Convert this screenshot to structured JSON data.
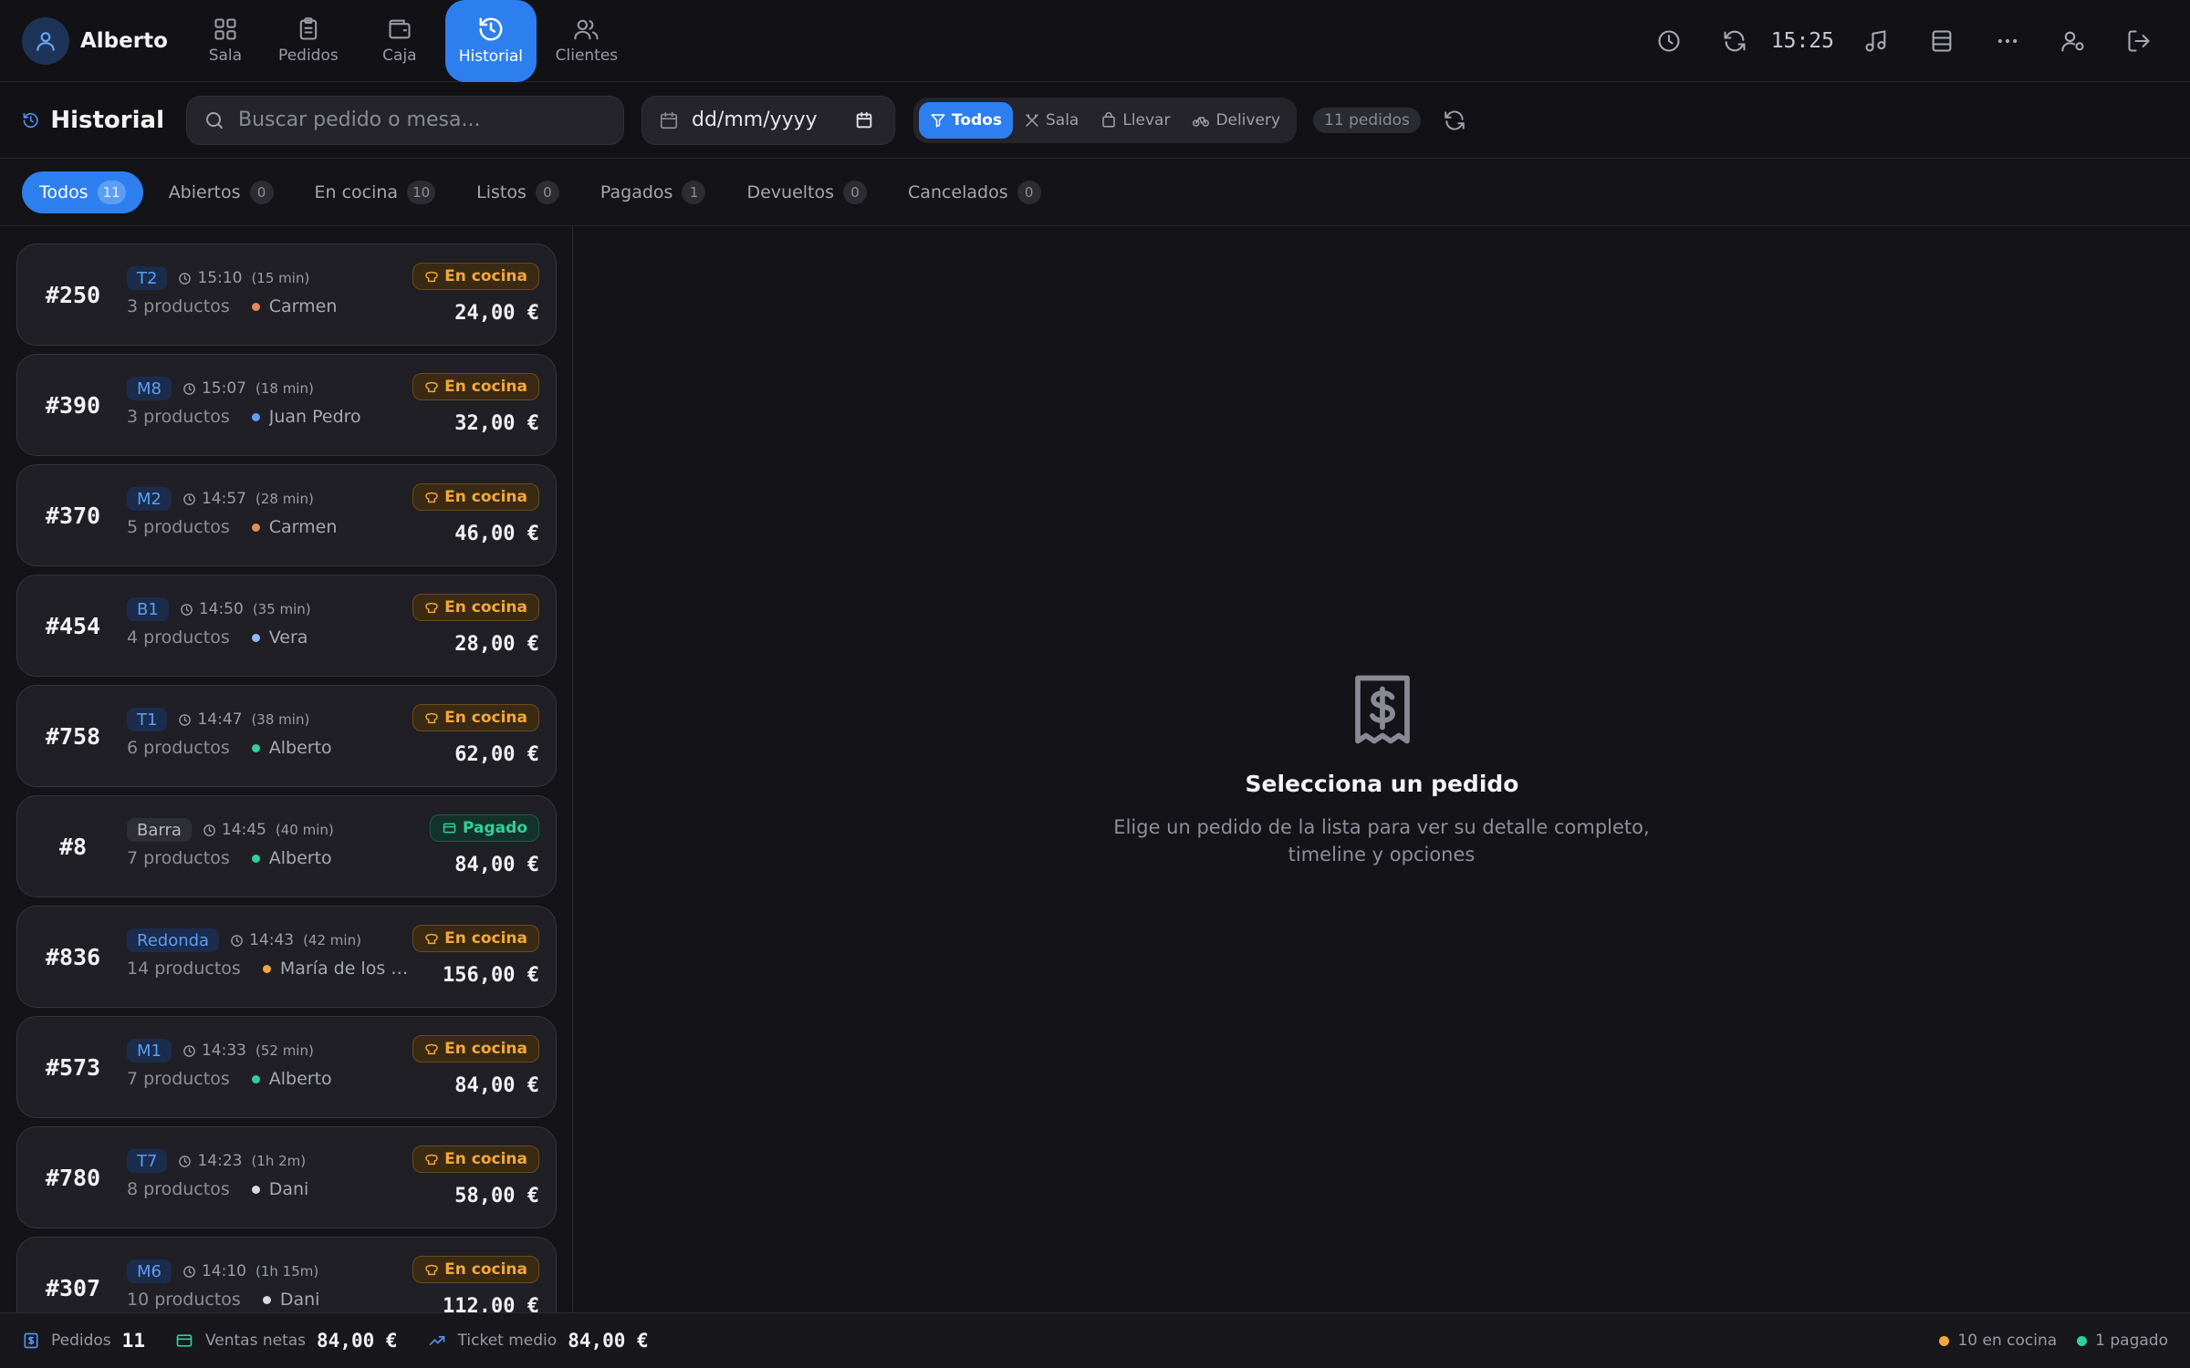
{
  "header": {
    "user_name": "Alberto",
    "nav": [
      {
        "label": "Sala",
        "icon": "grid-icon"
      },
      {
        "label": "Pedidos",
        "icon": "clipboard-icon"
      },
      {
        "label": "Caja",
        "icon": "wallet-icon"
      },
      {
        "label": "Historial",
        "icon": "history-icon",
        "active": true
      },
      {
        "label": "Clientes",
        "icon": "users-icon"
      }
    ],
    "clock": "15:25"
  },
  "toolbar": {
    "title": "Historial",
    "search_placeholder": "Buscar pedido o mesa...",
    "date_value": "dd/mm/yyyy",
    "filters": [
      {
        "label": "Todos",
        "active": true
      },
      {
        "label": "Sala"
      },
      {
        "label": "Llevar"
      },
      {
        "label": "Delivery"
      }
    ],
    "count_label": "11 pedidos"
  },
  "status_tabs": [
    {
      "label": "Todos",
      "count": "11",
      "active": true
    },
    {
      "label": "Abiertos",
      "count": "0"
    },
    {
      "label": "En cocina",
      "count": "10"
    },
    {
      "label": "Listos",
      "count": "0"
    },
    {
      "label": "Pagados",
      "count": "1"
    },
    {
      "label": "Devueltos",
      "count": "0"
    },
    {
      "label": "Cancelados",
      "count": "0"
    }
  ],
  "orders": [
    {
      "number": "#250",
      "table": "T2",
      "time": "15:10",
      "elapsed": "(15 min)",
      "products": "3 productos",
      "waiter": "Carmen",
      "waiter_color": "#e58a5a",
      "status": "En cocina",
      "status_type": "kitchen",
      "amount": "24,00 €"
    },
    {
      "number": "#390",
      "table": "M8",
      "time": "15:07",
      "elapsed": "(18 min)",
      "products": "3 productos",
      "waiter": "Juan Pedro",
      "waiter_color": "#5c9ef5",
      "status": "En cocina",
      "status_type": "kitchen",
      "amount": "32,00 €"
    },
    {
      "number": "#370",
      "table": "M2",
      "time": "14:57",
      "elapsed": "(28 min)",
      "products": "5 productos",
      "waiter": "Carmen",
      "waiter_color": "#e58a5a",
      "status": "En cocina",
      "status_type": "kitchen",
      "amount": "46,00 €"
    },
    {
      "number": "#454",
      "table": "B1",
      "time": "14:50",
      "elapsed": "(35 min)",
      "products": "4 productos",
      "waiter": "Vera",
      "waiter_color": "#8fb8f5",
      "status": "En cocina",
      "status_type": "kitchen",
      "amount": "28,00 €"
    },
    {
      "number": "#758",
      "table": "T1",
      "time": "14:47",
      "elapsed": "(38 min)",
      "products": "6 productos",
      "waiter": "Alberto",
      "waiter_color": "#2fd198",
      "status": "En cocina",
      "status_type": "kitchen",
      "amount": "62,00 €"
    },
    {
      "number": "#8",
      "table": "Barra",
      "table_style": "grey",
      "time": "14:45",
      "elapsed": "(40 min)",
      "products": "7 productos",
      "waiter": "Alberto",
      "waiter_color": "#2fd198",
      "status": "Pagado",
      "status_type": "paid",
      "amount": "84,00 €"
    },
    {
      "number": "#836",
      "table": "Redonda",
      "time": "14:43",
      "elapsed": "(42 min)",
      "products": "14 productos",
      "waiter": "María de los Ángeles",
      "waiter_color": "#f3a83a",
      "status": "En cocina",
      "status_type": "kitchen",
      "amount": "156,00 €"
    },
    {
      "number": "#573",
      "table": "M1",
      "time": "14:33",
      "elapsed": "(52 min)",
      "products": "7 productos",
      "waiter": "Alberto",
      "waiter_color": "#2fd198",
      "status": "En cocina",
      "status_type": "kitchen",
      "amount": "84,00 €"
    },
    {
      "number": "#780",
      "table": "T7",
      "time": "14:23",
      "elapsed": "(1h 2m)",
      "products": "8 productos",
      "waiter": "Dani",
      "waiter_color": "#d8d8e0",
      "status": "En cocina",
      "status_type": "kitchen",
      "amount": "58,00 €"
    },
    {
      "number": "#307",
      "table": "M6",
      "time": "14:10",
      "elapsed": "(1h 15m)",
      "products": "10 productos",
      "waiter": "Dani",
      "waiter_color": "#d8d8e0",
      "status": "En cocina",
      "status_type": "kitchen",
      "amount": "112,00 €"
    }
  ],
  "detail": {
    "empty_title": "Selecciona un pedido",
    "empty_text": "Elige un pedido de la lista para ver su detalle completo, timeline y opciones"
  },
  "footer": {
    "orders_label": "Pedidos",
    "orders_value": "11",
    "net_sales_label": "Ventas netas",
    "net_sales_value": "84,00 €",
    "avg_ticket_label": "Ticket medio",
    "avg_ticket_value": "84,00 €",
    "legend": [
      {
        "label": "10 en cocina",
        "color": "#f3a83a"
      },
      {
        "label": "1 pagado",
        "color": "#2fd198"
      }
    ]
  },
  "colors": {
    "accent": "#2d7ff0",
    "kitchen": "#f3a83a",
    "paid": "#2fd198",
    "background": "#131318"
  }
}
